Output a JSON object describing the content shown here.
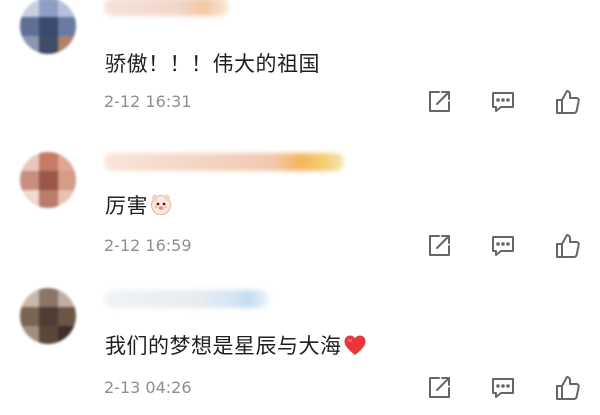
{
  "comments": [
    {
      "text": "骄傲！！！伟大的祖国",
      "time": "2-12 16:31",
      "emoji": ""
    },
    {
      "text": "厉害",
      "time": "2-12 16:59",
      "emoji": "cute-face-emoji"
    },
    {
      "text": "我们的梦想是星辰与大海",
      "time": "2-13 04:26",
      "emoji": "red-heart-emoji"
    }
  ],
  "actions": {
    "share_icon": "share-icon",
    "reply_icon": "comment-icon",
    "like_icon": "thumbs-up-icon"
  },
  "colors": {
    "time_text": "#8e8e8e",
    "icon_stroke": "#666666",
    "heart": "#e8363a"
  }
}
